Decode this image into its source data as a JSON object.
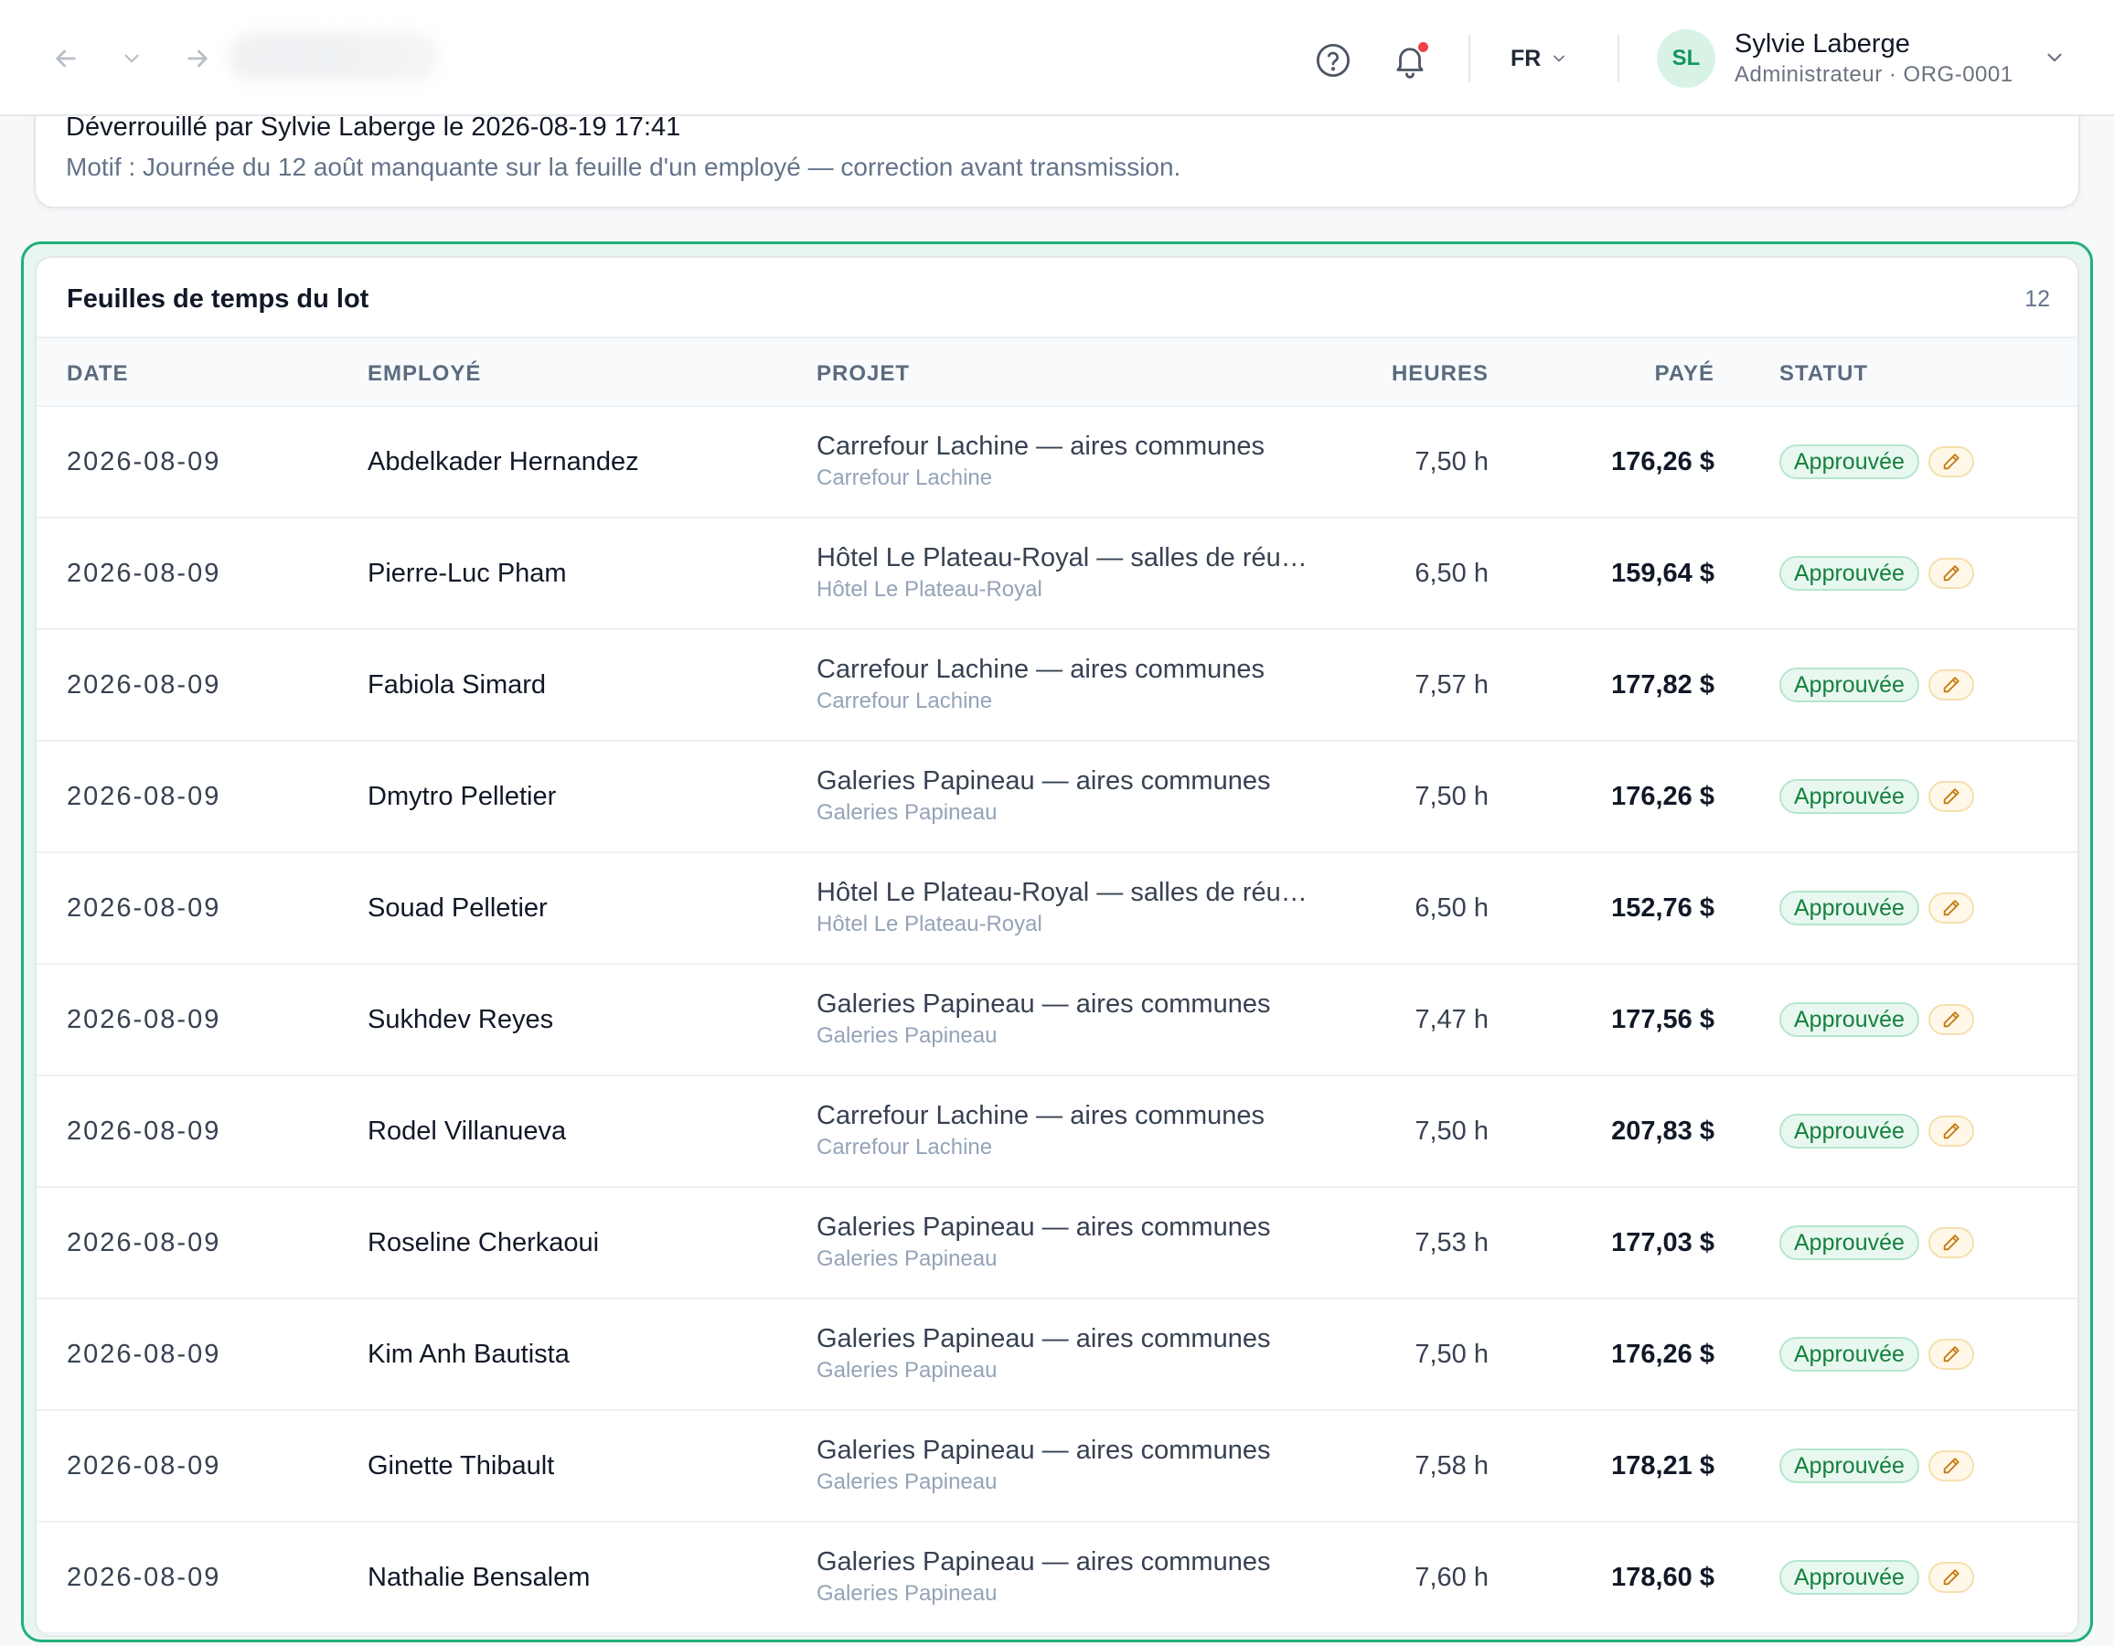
{
  "header": {
    "lang": "FR",
    "user": {
      "initials": "SL",
      "name": "Sylvie Laberge",
      "role": "Administrateur · ORG-0001"
    },
    "icons": [
      "arrow-left-icon",
      "chevron-down-icon",
      "arrow-right-icon",
      "help-icon",
      "bell-icon"
    ],
    "notification_color": "#ef4444"
  },
  "notice": {
    "unlocked_by": "Déverrouillé par Sylvie Laberge le 2026-08-19 17:41",
    "reason": "Motif : Journée du 12 août manquante sur la feuille d'un employé — correction avant transmission."
  },
  "timesheets": {
    "title": "Feuilles de temps du lot",
    "count": "12",
    "accent_color": "#22b07a",
    "columns": {
      "date": "DATE",
      "employee": "EMPLOYÉ",
      "project": "PROJET",
      "hours": "HEURES",
      "paid": "PAYÉ",
      "status": "STATUT"
    },
    "rows": [
      {
        "date": "2026-08-09",
        "employee": "Abdelkader Hernandez",
        "project": "Carrefour Lachine — aires communes",
        "client": "Carrefour Lachine",
        "hours": "7,50 h",
        "paid": "176,26 $",
        "status": "Approuvée"
      },
      {
        "date": "2026-08-09",
        "employee": "Pierre-Luc Pham",
        "project": "Hôtel Le Plateau-Royal — salles de réunion",
        "client": "Hôtel Le Plateau-Royal",
        "hours": "6,50 h",
        "paid": "159,64 $",
        "status": "Approuvée"
      },
      {
        "date": "2026-08-09",
        "employee": "Fabiola Simard",
        "project": "Carrefour Lachine — aires communes",
        "client": "Carrefour Lachine",
        "hours": "7,57 h",
        "paid": "177,82 $",
        "status": "Approuvée"
      },
      {
        "date": "2026-08-09",
        "employee": "Dmytro Pelletier",
        "project": "Galeries Papineau — aires communes",
        "client": "Galeries Papineau",
        "hours": "7,50 h",
        "paid": "176,26 $",
        "status": "Approuvée"
      },
      {
        "date": "2026-08-09",
        "employee": "Souad Pelletier",
        "project": "Hôtel Le Plateau-Royal — salles de réunion",
        "client": "Hôtel Le Plateau-Royal",
        "hours": "6,50 h",
        "paid": "152,76 $",
        "status": "Approuvée"
      },
      {
        "date": "2026-08-09",
        "employee": "Sukhdev Reyes",
        "project": "Galeries Papineau — aires communes",
        "client": "Galeries Papineau",
        "hours": "7,47 h",
        "paid": "177,56 $",
        "status": "Approuvée"
      },
      {
        "date": "2026-08-09",
        "employee": "Rodel Villanueva",
        "project": "Carrefour Lachine — aires communes",
        "client": "Carrefour Lachine",
        "hours": "7,50 h",
        "paid": "207,83 $",
        "status": "Approuvée"
      },
      {
        "date": "2026-08-09",
        "employee": "Roseline Cherkaoui",
        "project": "Galeries Papineau — aires communes",
        "client": "Galeries Papineau",
        "hours": "7,53 h",
        "paid": "177,03 $",
        "status": "Approuvée"
      },
      {
        "date": "2026-08-09",
        "employee": "Kim Anh Bautista",
        "project": "Galeries Papineau — aires communes",
        "client": "Galeries Papineau",
        "hours": "7,50 h",
        "paid": "176,26 $",
        "status": "Approuvée"
      },
      {
        "date": "2026-08-09",
        "employee": "Ginette Thibault",
        "project": "Galeries Papineau — aires communes",
        "client": "Galeries Papineau",
        "hours": "7,58 h",
        "paid": "178,21 $",
        "status": "Approuvée"
      },
      {
        "date": "2026-08-09",
        "employee": "Nathalie Bensalem",
        "project": "Galeries Papineau — aires communes",
        "client": "Galeries Papineau",
        "hours": "7,60 h",
        "paid": "178,60 $",
        "status": "Approuvée"
      }
    ],
    "row_icon": "pencil-icon"
  }
}
